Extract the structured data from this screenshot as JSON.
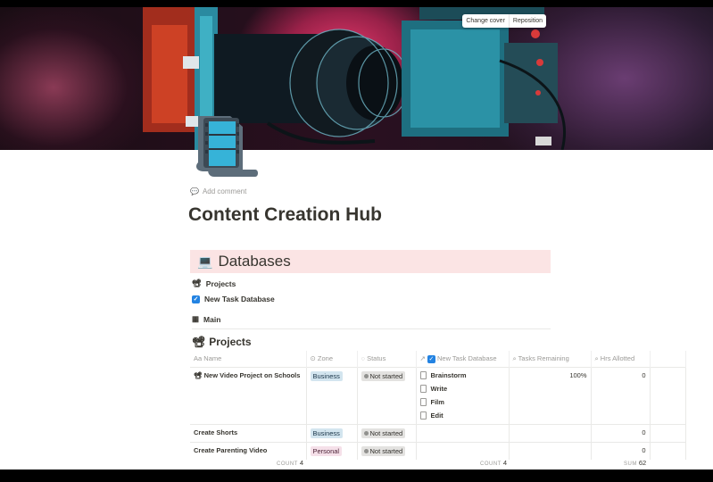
{
  "cover": {
    "change_cover": "Change cover",
    "reposition": "Reposition"
  },
  "add_comment": "Add comment",
  "title": "Content Creation Hub",
  "callout": {
    "emoji": "💻",
    "heading": "Databases"
  },
  "links": [
    {
      "emoji": "📽",
      "label": "Projects"
    },
    {
      "label": "New Task Database"
    },
    {
      "label": "Main"
    }
  ],
  "database": {
    "emoji": "📽",
    "title": "Projects",
    "columns": [
      "Name",
      "Zone",
      "Status",
      "New Task Database",
      "Tasks Remaining",
      "Hrs Allotted"
    ],
    "column_prefixes": [
      "Aa",
      "⊙",
      "",
      "↗",
      "",
      ""
    ],
    "rows": [
      {
        "name": "New Video Project on Schools",
        "name_emoji": "📽",
        "zone": "Business",
        "status": "Not started",
        "tasks": [
          "Brainstorm",
          "Write",
          "Film",
          "Edit"
        ],
        "remaining": "100%",
        "hrs": "0"
      },
      {
        "name": "Create Shorts",
        "zone": "Business",
        "status": "Not started",
        "tasks": [],
        "remaining": "",
        "hrs": "0"
      },
      {
        "name": "Create Parenting Video",
        "zone": "Personal",
        "status": "Not started",
        "tasks": [],
        "remaining": "",
        "hrs": "0"
      }
    ],
    "footer": {
      "count_label": "COUNT",
      "count_value": "4",
      "tasks_count_label": "COUNT",
      "tasks_count_value": "4",
      "sum_label": "SUM",
      "sum_value": "62"
    }
  },
  "colors": {
    "callout_bg": "#fbe4e4",
    "business_tag": "#d3e5ef",
    "personal_tag": "#f5e0e9",
    "checkbox": "#2383e2"
  }
}
